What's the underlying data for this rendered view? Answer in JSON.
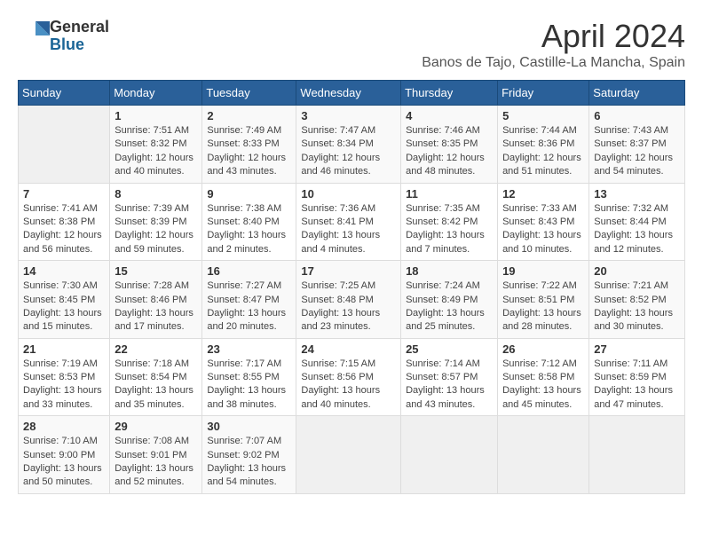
{
  "header": {
    "logo_line1": "General",
    "logo_line2": "Blue",
    "month_title": "April 2024",
    "location": "Banos de Tajo, Castille-La Mancha, Spain"
  },
  "days_of_week": [
    "Sunday",
    "Monday",
    "Tuesday",
    "Wednesday",
    "Thursday",
    "Friday",
    "Saturday"
  ],
  "weeks": [
    [
      {
        "day": "",
        "empty": true
      },
      {
        "day": "1",
        "sunrise": "Sunrise: 7:51 AM",
        "sunset": "Sunset: 8:32 PM",
        "daylight": "Daylight: 12 hours and 40 minutes."
      },
      {
        "day": "2",
        "sunrise": "Sunrise: 7:49 AM",
        "sunset": "Sunset: 8:33 PM",
        "daylight": "Daylight: 12 hours and 43 minutes."
      },
      {
        "day": "3",
        "sunrise": "Sunrise: 7:47 AM",
        "sunset": "Sunset: 8:34 PM",
        "daylight": "Daylight: 12 hours and 46 minutes."
      },
      {
        "day": "4",
        "sunrise": "Sunrise: 7:46 AM",
        "sunset": "Sunset: 8:35 PM",
        "daylight": "Daylight: 12 hours and 48 minutes."
      },
      {
        "day": "5",
        "sunrise": "Sunrise: 7:44 AM",
        "sunset": "Sunset: 8:36 PM",
        "daylight": "Daylight: 12 hours and 51 minutes."
      },
      {
        "day": "6",
        "sunrise": "Sunrise: 7:43 AM",
        "sunset": "Sunset: 8:37 PM",
        "daylight": "Daylight: 12 hours and 54 minutes."
      }
    ],
    [
      {
        "day": "7",
        "sunrise": "Sunrise: 7:41 AM",
        "sunset": "Sunset: 8:38 PM",
        "daylight": "Daylight: 12 hours and 56 minutes."
      },
      {
        "day": "8",
        "sunrise": "Sunrise: 7:39 AM",
        "sunset": "Sunset: 8:39 PM",
        "daylight": "Daylight: 12 hours and 59 minutes."
      },
      {
        "day": "9",
        "sunrise": "Sunrise: 7:38 AM",
        "sunset": "Sunset: 8:40 PM",
        "daylight": "Daylight: 13 hours and 2 minutes."
      },
      {
        "day": "10",
        "sunrise": "Sunrise: 7:36 AM",
        "sunset": "Sunset: 8:41 PM",
        "daylight": "Daylight: 13 hours and 4 minutes."
      },
      {
        "day": "11",
        "sunrise": "Sunrise: 7:35 AM",
        "sunset": "Sunset: 8:42 PM",
        "daylight": "Daylight: 13 hours and 7 minutes."
      },
      {
        "day": "12",
        "sunrise": "Sunrise: 7:33 AM",
        "sunset": "Sunset: 8:43 PM",
        "daylight": "Daylight: 13 hours and 10 minutes."
      },
      {
        "day": "13",
        "sunrise": "Sunrise: 7:32 AM",
        "sunset": "Sunset: 8:44 PM",
        "daylight": "Daylight: 13 hours and 12 minutes."
      }
    ],
    [
      {
        "day": "14",
        "sunrise": "Sunrise: 7:30 AM",
        "sunset": "Sunset: 8:45 PM",
        "daylight": "Daylight: 13 hours and 15 minutes."
      },
      {
        "day": "15",
        "sunrise": "Sunrise: 7:28 AM",
        "sunset": "Sunset: 8:46 PM",
        "daylight": "Daylight: 13 hours and 17 minutes."
      },
      {
        "day": "16",
        "sunrise": "Sunrise: 7:27 AM",
        "sunset": "Sunset: 8:47 PM",
        "daylight": "Daylight: 13 hours and 20 minutes."
      },
      {
        "day": "17",
        "sunrise": "Sunrise: 7:25 AM",
        "sunset": "Sunset: 8:48 PM",
        "daylight": "Daylight: 13 hours and 23 minutes."
      },
      {
        "day": "18",
        "sunrise": "Sunrise: 7:24 AM",
        "sunset": "Sunset: 8:49 PM",
        "daylight": "Daylight: 13 hours and 25 minutes."
      },
      {
        "day": "19",
        "sunrise": "Sunrise: 7:22 AM",
        "sunset": "Sunset: 8:51 PM",
        "daylight": "Daylight: 13 hours and 28 minutes."
      },
      {
        "day": "20",
        "sunrise": "Sunrise: 7:21 AM",
        "sunset": "Sunset: 8:52 PM",
        "daylight": "Daylight: 13 hours and 30 minutes."
      }
    ],
    [
      {
        "day": "21",
        "sunrise": "Sunrise: 7:19 AM",
        "sunset": "Sunset: 8:53 PM",
        "daylight": "Daylight: 13 hours and 33 minutes."
      },
      {
        "day": "22",
        "sunrise": "Sunrise: 7:18 AM",
        "sunset": "Sunset: 8:54 PM",
        "daylight": "Daylight: 13 hours and 35 minutes."
      },
      {
        "day": "23",
        "sunrise": "Sunrise: 7:17 AM",
        "sunset": "Sunset: 8:55 PM",
        "daylight": "Daylight: 13 hours and 38 minutes."
      },
      {
        "day": "24",
        "sunrise": "Sunrise: 7:15 AM",
        "sunset": "Sunset: 8:56 PM",
        "daylight": "Daylight: 13 hours and 40 minutes."
      },
      {
        "day": "25",
        "sunrise": "Sunrise: 7:14 AM",
        "sunset": "Sunset: 8:57 PM",
        "daylight": "Daylight: 13 hours and 43 minutes."
      },
      {
        "day": "26",
        "sunrise": "Sunrise: 7:12 AM",
        "sunset": "Sunset: 8:58 PM",
        "daylight": "Daylight: 13 hours and 45 minutes."
      },
      {
        "day": "27",
        "sunrise": "Sunrise: 7:11 AM",
        "sunset": "Sunset: 8:59 PM",
        "daylight": "Daylight: 13 hours and 47 minutes."
      }
    ],
    [
      {
        "day": "28",
        "sunrise": "Sunrise: 7:10 AM",
        "sunset": "Sunset: 9:00 PM",
        "daylight": "Daylight: 13 hours and 50 minutes."
      },
      {
        "day": "29",
        "sunrise": "Sunrise: 7:08 AM",
        "sunset": "Sunset: 9:01 PM",
        "daylight": "Daylight: 13 hours and 52 minutes."
      },
      {
        "day": "30",
        "sunrise": "Sunrise: 7:07 AM",
        "sunset": "Sunset: 9:02 PM",
        "daylight": "Daylight: 13 hours and 54 minutes."
      },
      {
        "day": "",
        "empty": true
      },
      {
        "day": "",
        "empty": true
      },
      {
        "day": "",
        "empty": true
      },
      {
        "day": "",
        "empty": true
      }
    ]
  ]
}
